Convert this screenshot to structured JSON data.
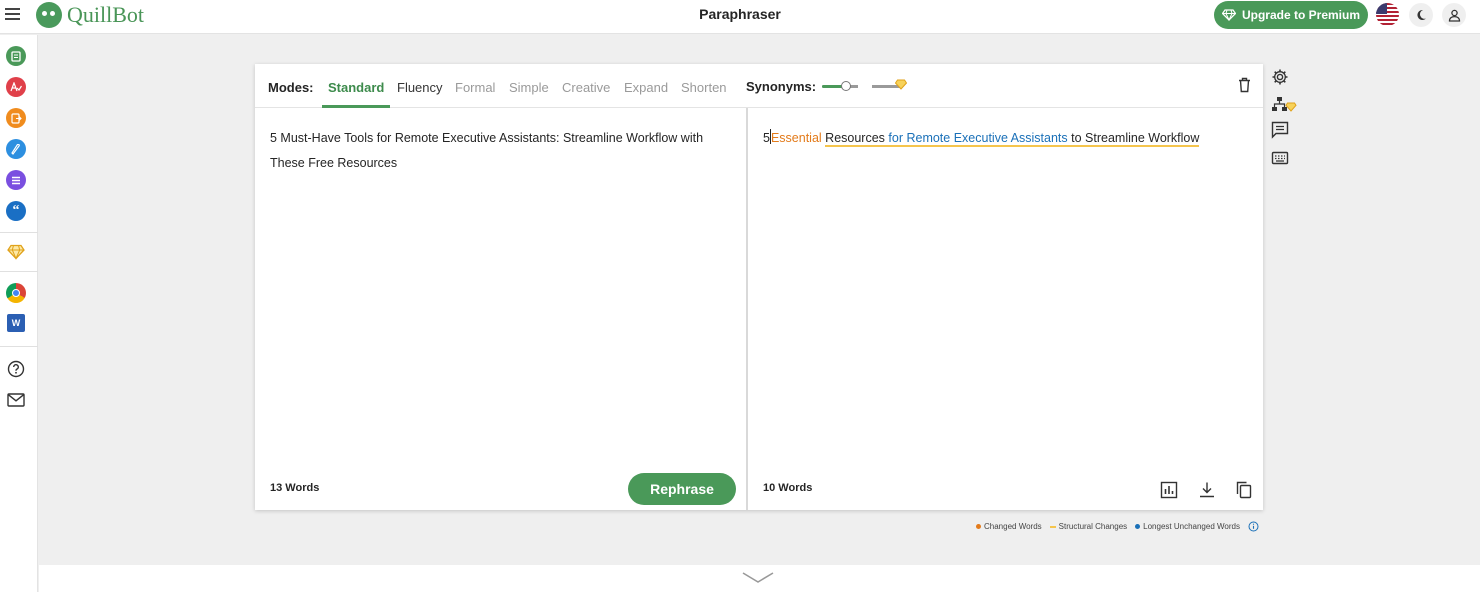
{
  "app": {
    "name": "QuillBot",
    "page_title": "Paraphraser"
  },
  "header": {
    "upgrade_label": "Upgrade to Premium"
  },
  "sidebar": {
    "items": [
      {
        "name": "paraphraser-icon",
        "color": "#4a9959"
      },
      {
        "name": "grammar-checker-icon",
        "color": "#e0404a"
      },
      {
        "name": "plagiarism-checker-icon",
        "color": "#f08c1e"
      },
      {
        "name": "co-writer-icon",
        "color": "#2d8fe0"
      },
      {
        "name": "summarizer-icon",
        "color": "#7a4fe0"
      },
      {
        "name": "citation-generator-icon",
        "color": "#1a6fc4"
      }
    ]
  },
  "modes": {
    "label": "Modes:",
    "tabs": [
      "Standard",
      "Fluency",
      "Formal",
      "Simple",
      "Creative",
      "Expand",
      "Shorten"
    ],
    "active": "Standard",
    "synonyms_label": "Synonyms:",
    "synonyms_level": 0.3
  },
  "input": {
    "text": "5 Must-Have Tools for Remote Executive Assistants: Streamline Workflow with These Free Resources",
    "word_count": "13 Words"
  },
  "output": {
    "segments": [
      {
        "text": "5",
        "type": "plain"
      },
      {
        "text": "Essential",
        "type": "changed"
      },
      {
        "text": " ",
        "type": "plain"
      },
      {
        "text": "Resources ",
        "type": "struct"
      },
      {
        "text": "for Remote Executive Assistants",
        "type": "unchanged-struct"
      },
      {
        "text": " to Streamline Workflow",
        "type": "struct"
      }
    ],
    "word_count": "10 Words"
  },
  "actions": {
    "rephrase_label": "Rephrase"
  },
  "legend": {
    "changed": "Changed Words",
    "structural": "Structural Changes",
    "unchanged": "Longest Unchanged Words"
  },
  "colors": {
    "brand": "#4a9959",
    "changed": "#e37b1b",
    "structural": "#f5c54d",
    "unchanged": "#1a70b8"
  }
}
